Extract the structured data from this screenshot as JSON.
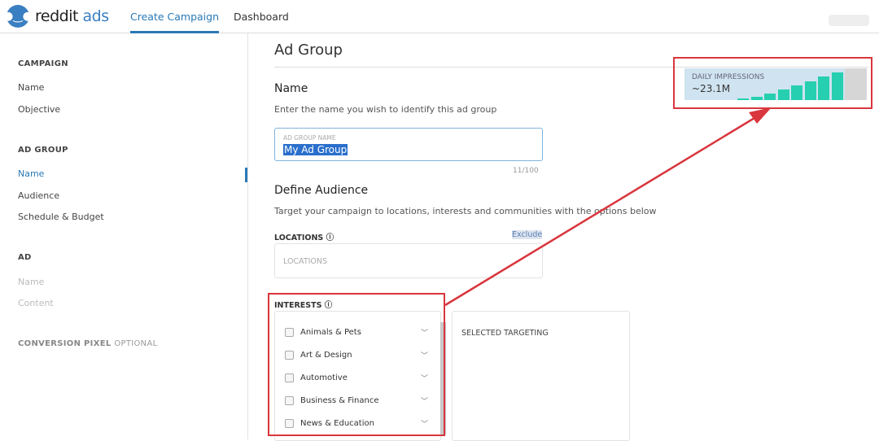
{
  "header": {
    "logo_main": "reddit",
    "logo_accent": "ads",
    "tabs": [
      {
        "label": "Create Campaign",
        "active": true
      },
      {
        "label": "Dashboard",
        "active": false
      }
    ]
  },
  "sidebar": {
    "campaign_heading": "CAMPAIGN",
    "campaign_items": [
      "Name",
      "Objective"
    ],
    "adgroup_heading": "AD GROUP",
    "adgroup_items": [
      "Name",
      "Audience",
      "Schedule & Budget"
    ],
    "ad_heading": "AD",
    "ad_items": [
      "Name",
      "Content"
    ],
    "pixel_heading": "CONVERSION PIXEL",
    "pixel_optional": "OPTIONAL"
  },
  "main": {
    "title": "Ad Group",
    "name_heading": "Name",
    "name_desc": "Enter the name you wish to identify this ad group",
    "name_field_label": "AD GROUP NAME",
    "name_field_value": "My Ad Group",
    "char_count": "11/100",
    "audience_heading": "Define Audience",
    "audience_desc": "Target your campaign to locations, interests and communities with the options below",
    "locations_label": "LOCATIONS",
    "exclude_link": "Exclude",
    "locations_placeholder": "LOCATIONS",
    "interests_label": "INTERESTS",
    "interests": [
      "Animals & Pets",
      "Art & Design",
      "Automotive",
      "Business & Finance",
      "News & Education"
    ],
    "selected_targeting": "SELECTED TARGETING"
  },
  "impressions": {
    "label": "DAILY IMPRESSIONS",
    "value": "~23.1M",
    "bar_levels": [
      0.06,
      0.1,
      0.22,
      0.35,
      0.48,
      0.62,
      0.78,
      0.92
    ],
    "bar_color": "#26cfb0"
  },
  "colors": {
    "accent": "#2a79b6",
    "highlight": "#d9363e"
  }
}
